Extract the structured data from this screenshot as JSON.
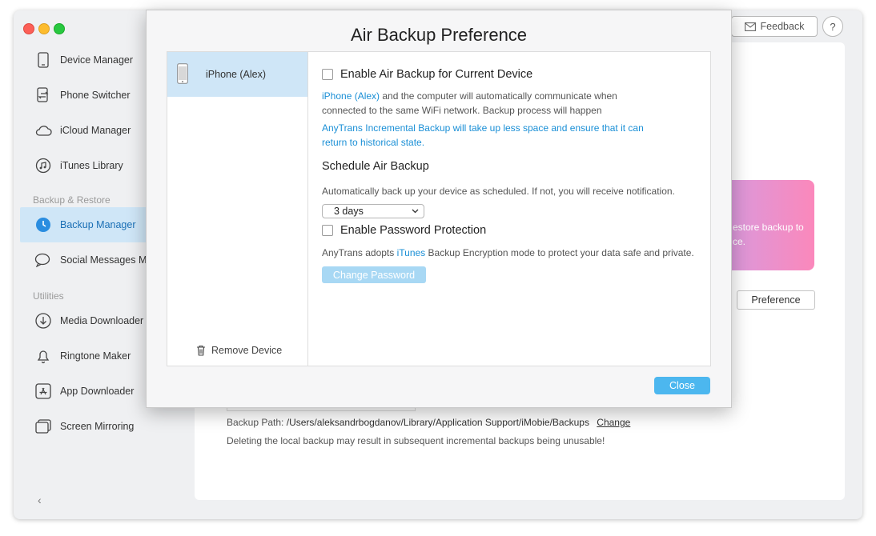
{
  "sidebar": {
    "items_top": [
      {
        "label": "Device Manager",
        "icon": "phone-icon"
      },
      {
        "label": "Phone Switcher",
        "icon": "switch-icon"
      },
      {
        "label": "iCloud Manager",
        "icon": "cloud-icon"
      },
      {
        "label": "iTunes Library",
        "icon": "music-icon"
      }
    ],
    "section_backup": "Backup & Restore",
    "items_backup": [
      {
        "label": "Backup Manager",
        "icon": "clock-icon",
        "active": true
      },
      {
        "label": "Social Messages Ma",
        "icon": "chat-icon"
      }
    ],
    "section_utilities": "Utilities",
    "items_utilities": [
      {
        "label": "Media Downloader",
        "icon": "download-icon"
      },
      {
        "label": "Ringtone Maker",
        "icon": "bell-icon"
      },
      {
        "label": "App Downloader",
        "icon": "app-store-icon"
      },
      {
        "label": "Screen Mirroring",
        "icon": "screen-icon"
      }
    ],
    "collapse_glyph": "‹"
  },
  "toolbar": {
    "feedback_label": "Feedback",
    "help_label": "?"
  },
  "background": {
    "promo_line1": "estore backup to",
    "promo_line2": "ce.",
    "preference_label": "Preference",
    "backup_path_label": "Backup Path:",
    "backup_path_value": "/Users/aleksandrbogdanov/Library/Application Support/iMobie/Backups",
    "backup_path_change": "Change",
    "warning": "Deleting the local backup may result in subsequent incremental backups being unusable!"
  },
  "modal": {
    "title": "Air Backup Preference",
    "device_name": "iPhone (Alex)",
    "remove_device": "Remove Device",
    "enable_air_backup": "Enable Air Backup for Current Device",
    "desc1_link": "iPhone (Alex)",
    "desc1_rest": " and the computer will automatically communicate when",
    "desc2": "connected to the same WiFi network. Backup process will happen",
    "incremental1": "AnyTrans Incremental Backup will take up less space and ensure that it can",
    "incremental2": "return to historical state.",
    "schedule_heading": "Schedule Air Backup",
    "schedule_desc": "Automatically back up your device as scheduled. If not, you will receive notification.",
    "schedule_value": "3 days",
    "enable_password": "Enable Password Protection",
    "enc_prefix": "AnyTrans adopts ",
    "enc_link": "iTunes",
    "enc_suffix": " Backup Encryption mode to protect your data safe and private.",
    "change_password": "Change Password",
    "close": "Close"
  }
}
